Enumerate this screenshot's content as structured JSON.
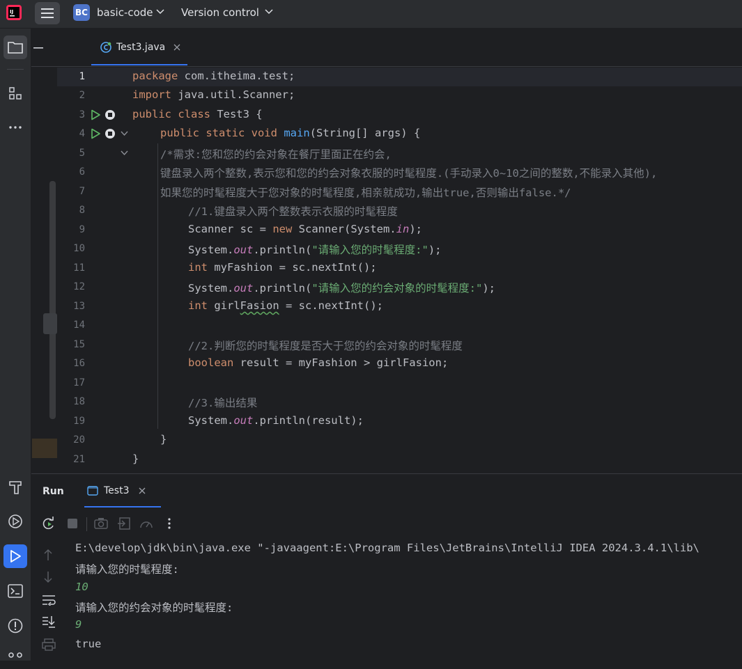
{
  "titlebar": {
    "project_badge": "BC",
    "project_name": "basic-code",
    "vcs_label": "Version control"
  },
  "toolstrip": {
    "icons": [
      "project-folder-icon",
      "structure-icon",
      "more-icon",
      "build-hammer-icon",
      "services-icon",
      "run-icon",
      "terminal-icon",
      "problems-icon",
      "git-icon"
    ]
  },
  "editor": {
    "tab_label": "Test3.java",
    "lines": [
      {
        "n": "1"
      },
      {
        "n": "2"
      },
      {
        "n": "3"
      },
      {
        "n": "4"
      },
      {
        "n": "5"
      },
      {
        "n": "6"
      },
      {
        "n": "7"
      },
      {
        "n": "8"
      },
      {
        "n": "9"
      },
      {
        "n": "10"
      },
      {
        "n": "11"
      },
      {
        "n": "12"
      },
      {
        "n": "13"
      },
      {
        "n": "14"
      },
      {
        "n": "15"
      },
      {
        "n": "16"
      },
      {
        "n": "17"
      },
      {
        "n": "18"
      },
      {
        "n": "19"
      },
      {
        "n": "20"
      },
      {
        "n": "21"
      }
    ],
    "code": {
      "l1_kw": "package",
      "l1_rest": " com.itheima.test;",
      "l2_kw": "import",
      "l2_rest": " java.util.Scanner;",
      "l3_kw": "public class",
      "l3_rest": " Test3 {",
      "l4_kw": "public static void",
      "l4_fn": "main",
      "l4_rest": "(String[] args) {",
      "l5": "/*需求:您和您的约会对象在餐厅里面正在约会,",
      "l6": "键盘录入两个整数,表示您和您的约会对象衣服的时髦程度.(手动录入0~10之间的整数,不能录入其他),",
      "l7": "如果您的时髦程度大于您对象的时髦程度,相亲就成功,输出true,否则输出false.*/",
      "l8": "//1.键盘录入两个整数表示衣服的时髦程度",
      "l9_a": "Scanner sc = ",
      "l9_kw": "new",
      "l9_b": " Scanner(System.",
      "l9_fld": "in",
      "l9_c": ");",
      "l10_a": "System.",
      "l10_fld": "out",
      "l10_b": ".println(",
      "l10_str": "\"请输入您的时髦程度:\"",
      "l10_c": ");",
      "l11_kw": "int",
      "l11_rest": " myFashion = sc.nextInt();",
      "l12_a": "System.",
      "l12_fld": "out",
      "l12_b": ".println(",
      "l12_str": "\"请输入您的约会对象的时髦程度:\"",
      "l12_c": ");",
      "l13_kw": "int",
      "l13_a": " girl",
      "l13_sq": "Fasion",
      "l13_b": " = sc.nextInt();",
      "l15": "//2.判断您的时髦程度是否大于您的约会对象的时髦程度",
      "l16_kw": "boolean",
      "l16_rest": " result = myFashion > girlFasion;",
      "l18": "//3.输出结果",
      "l19_a": "System.",
      "l19_fld": "out",
      "l19_b": ".println(result);",
      "l20": "}",
      "l21": "}"
    }
  },
  "run_panel": {
    "title": "Run",
    "tab_label": "Test3",
    "console": [
      "E:\\develop\\jdk\\bin\\java.exe \"-javaagent:E:\\Program Files\\JetBrains\\IntelliJ IDEA 2024.3.4.1\\lib\\",
      "请输入您的时髦程度:",
      "10",
      "请输入您的约会对象的时髦程度:",
      "9",
      "true"
    ]
  },
  "colors": {
    "accent": "#3574f0",
    "keyword": "#cf8e6d",
    "string": "#6aab73",
    "function": "#56a8f5",
    "field": "#c77dbb",
    "comment": "#7a7e85",
    "run_green": "#5fb865"
  }
}
